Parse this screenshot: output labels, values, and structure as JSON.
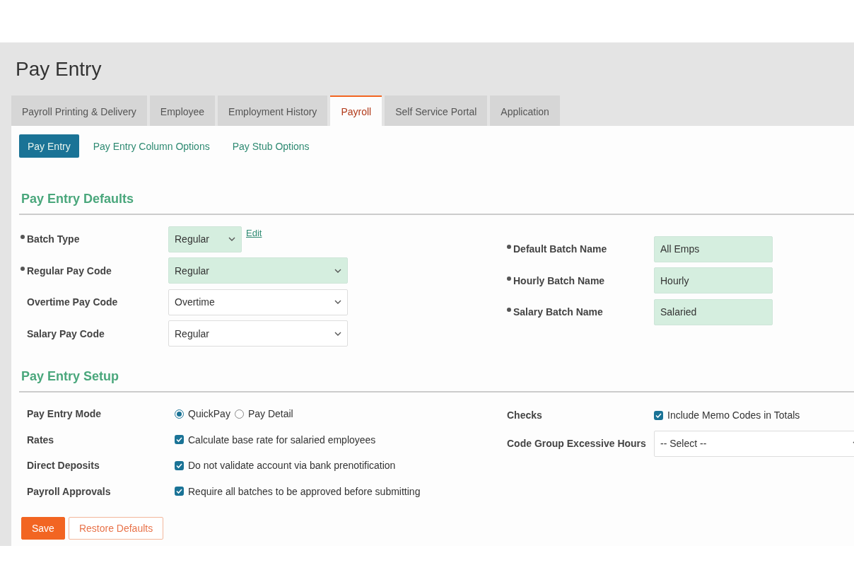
{
  "page_title": "Pay Entry",
  "tabs": [
    {
      "label": "Payroll Printing & Delivery",
      "selected": false
    },
    {
      "label": "Employee",
      "selected": false
    },
    {
      "label": "Employment History",
      "selected": false
    },
    {
      "label": "Payroll",
      "selected": true
    },
    {
      "label": "Self Service Portal",
      "selected": false
    },
    {
      "label": "Application",
      "selected": false
    }
  ],
  "subtabs": [
    {
      "label": "Pay Entry",
      "selected": true
    },
    {
      "label": "Pay Entry Column Options",
      "selected": false
    },
    {
      "label": "Pay Stub Options",
      "selected": false
    }
  ],
  "defaults": {
    "title": "Pay Entry Defaults",
    "left": [
      {
        "label": "Batch Type",
        "required": true,
        "kind": "select",
        "value": "Regular",
        "compact": true,
        "link": "Edit"
      },
      {
        "label": "Regular Pay Code",
        "required": true,
        "kind": "select",
        "value": "Regular"
      },
      {
        "label": "Overtime Pay Code",
        "required": false,
        "kind": "select",
        "value": "Overtime"
      },
      {
        "label": "Salary Pay Code",
        "required": false,
        "kind": "select",
        "value": "Regular"
      }
    ],
    "right": [
      {
        "label": "Default Batch Name",
        "required": true,
        "kind": "text",
        "value": "All Emps"
      },
      {
        "label": "Hourly Batch Name",
        "required": true,
        "kind": "text",
        "value": "Hourly"
      },
      {
        "label": "Salary Batch Name",
        "required": true,
        "kind": "text",
        "value": "Salaried"
      }
    ]
  },
  "setup": {
    "title": "Pay Entry Setup",
    "left": [
      {
        "label": "Pay Entry Mode",
        "kind": "radio",
        "options": [
          {
            "label": "QuickPay",
            "selected": true
          },
          {
            "label": "Pay Detail",
            "selected": false
          }
        ]
      },
      {
        "label": "Rates",
        "kind": "checkbox",
        "text": "Calculate base rate for salaried employees",
        "checked": true
      },
      {
        "label": "Direct Deposits",
        "kind": "checkbox",
        "text": "Do not validate account via bank prenotification",
        "checked": true
      },
      {
        "label": "Payroll Approvals",
        "kind": "checkbox",
        "text": "Require all batches to be approved before submitting",
        "checked": true
      }
    ],
    "right": [
      {
        "label": "Checks",
        "kind": "checkbox",
        "text": "Include Memo Codes in Totals",
        "checked": true
      },
      {
        "label": "Code Group Excessive Hours",
        "kind": "select",
        "value": "-- Select --",
        "stretched": true
      }
    ]
  },
  "buttons": [
    {
      "label": "Save",
      "kind": "primary"
    },
    {
      "label": "Restore Defaults",
      "kind": "secondary"
    }
  ]
}
